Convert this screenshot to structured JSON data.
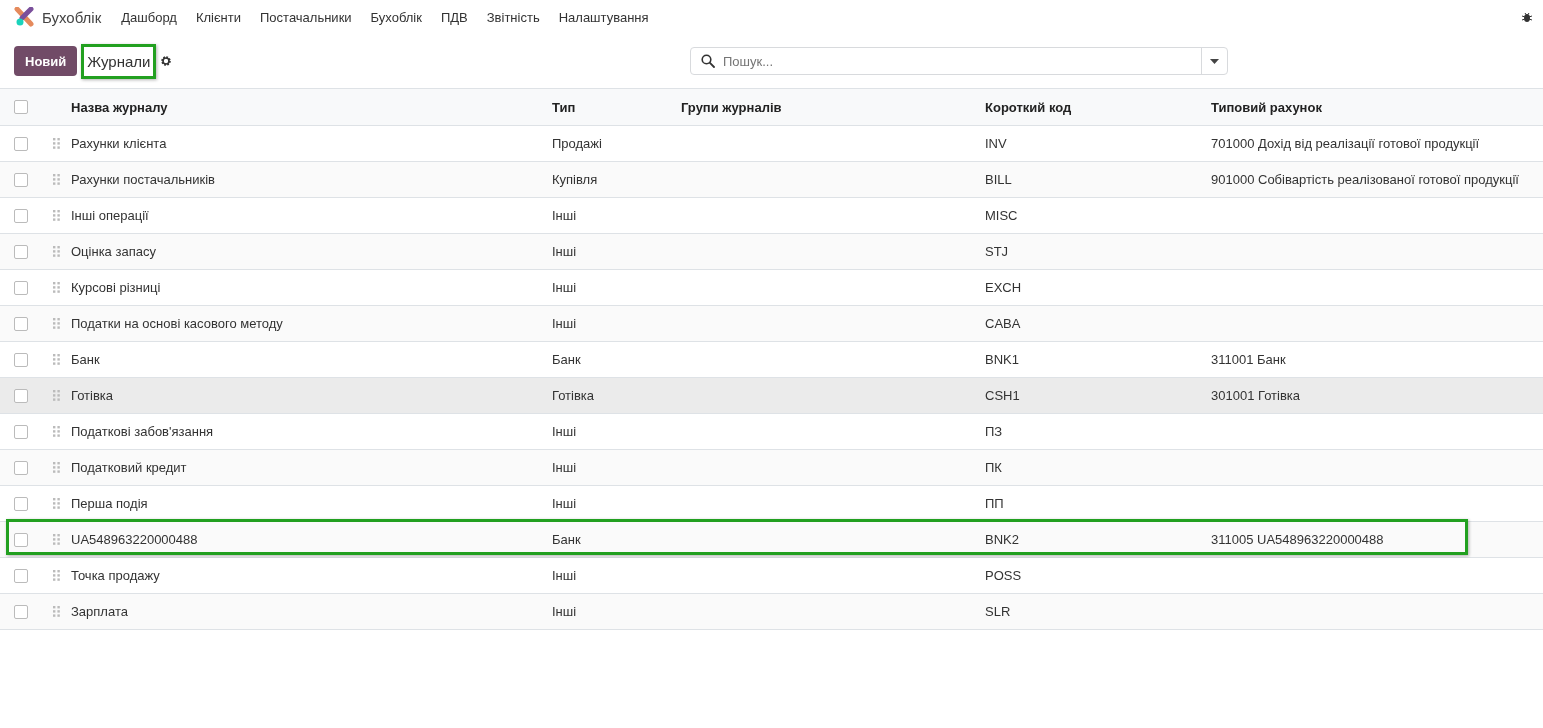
{
  "navbar": {
    "app_name": "Бухоблік",
    "menu": [
      "Дашборд",
      "Клієнти",
      "Постачальники",
      "Бухоблік",
      "ПДВ",
      "Звітність",
      "Налаштування"
    ]
  },
  "control_panel": {
    "new_button": "Новий",
    "breadcrumb": "Журнали",
    "breadcrumb_highlighted": true,
    "search": {
      "placeholder": "Пошук..."
    }
  },
  "table": {
    "all_checked": false,
    "columns": [
      "Назва журналу",
      "Тип",
      "Групи журналів",
      "Короткий код",
      "Типовий рахунок"
    ],
    "rows": [
      {
        "name": "Рахунки клієнта",
        "type": "Продажі",
        "code": "INV",
        "account": "701000 Дохід від реалізації готової продукції",
        "checked": false,
        "hovered": false,
        "highlighted": false
      },
      {
        "name": "Рахунки постачальників",
        "type": "Купівля",
        "code": "BILL",
        "account": "901000 Собівартість реалізованої готової продукції",
        "checked": false,
        "hovered": false,
        "highlighted": false
      },
      {
        "name": "Інші операції",
        "type": "Інші",
        "code": "MISC",
        "checked": false,
        "hovered": false,
        "highlighted": false
      },
      {
        "name": "Оцінка запасу",
        "type": "Інші",
        "code": "STJ",
        "checked": false,
        "hovered": false,
        "highlighted": false
      },
      {
        "name": "Курсові різниці",
        "type": "Інші",
        "code": "EXCH",
        "checked": false,
        "hovered": false,
        "highlighted": false
      },
      {
        "name": "Податки на основі касового методу",
        "type": "Інші",
        "code": "CABA",
        "checked": false,
        "hovered": false,
        "highlighted": false
      },
      {
        "name": "Банк",
        "type": "Банк",
        "code": "BNK1",
        "account": "311001 Банк",
        "checked": false,
        "hovered": false,
        "highlighted": false
      },
      {
        "name": "Готівка",
        "type": "Готівка",
        "code": "CSH1",
        "account": "301001 Готівка",
        "checked": false,
        "hovered": true,
        "highlighted": false
      },
      {
        "name": "Податкові забов'язання",
        "type": "Інші",
        "code": "ПЗ",
        "checked": false,
        "hovered": false,
        "highlighted": false
      },
      {
        "name": "Податковий кредит",
        "type": "Інші",
        "code": "ПК",
        "checked": false,
        "hovered": false,
        "highlighted": false
      },
      {
        "name": "Перша подія",
        "type": "Інші",
        "code": "ПП",
        "checked": false,
        "hovered": false,
        "highlighted": false
      },
      {
        "name": "UA548963220000488",
        "type": "Банк",
        "code": "BNK2",
        "account": "311005 UA548963220000488",
        "checked": false,
        "hovered": false,
        "highlighted": true
      },
      {
        "name": "Точка продажу",
        "type": "Інші",
        "code": "POSS",
        "checked": false,
        "hovered": false,
        "highlighted": false
      },
      {
        "name": "Зарплата",
        "type": "Інші",
        "code": "SLR",
        "checked": false,
        "hovered": false,
        "highlighted": false
      }
    ]
  }
}
